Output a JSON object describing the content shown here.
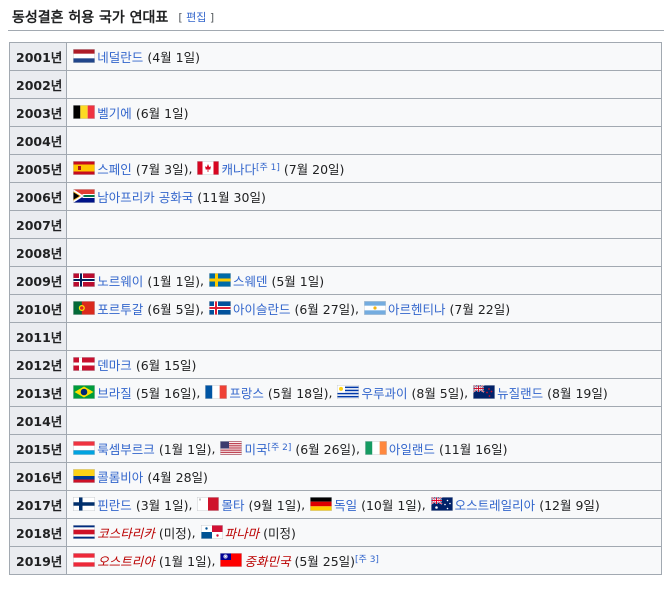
{
  "section": {
    "title": "동성결혼 허용 국가 연대표",
    "edit_open": "[",
    "edit_label": "편집",
    "edit_close": "]"
  },
  "rows": [
    {
      "year": "2001년",
      "entries": [
        {
          "flag": "netherlands-flag-icon",
          "name": "네덜란드",
          "date": "(4월 1일)"
        }
      ]
    },
    {
      "year": "2002년",
      "entries": []
    },
    {
      "year": "2003년",
      "entries": [
        {
          "flag": "belgium-flag-icon",
          "name": "벨기에",
          "date": "(6월 1일)"
        }
      ]
    },
    {
      "year": "2004년",
      "entries": []
    },
    {
      "year": "2005년",
      "entries": [
        {
          "flag": "spain-flag-icon",
          "name": "스페인",
          "date": "(7월 3일)"
        },
        {
          "flag": "canada-flag-icon",
          "name": "캐나다",
          "note": "[주 1]",
          "date": "(7월 20일)"
        }
      ]
    },
    {
      "year": "2006년",
      "entries": [
        {
          "flag": "south-africa-flag-icon",
          "name": "남아프리카 공화국",
          "date": "(11월 30일)"
        }
      ]
    },
    {
      "year": "2007년",
      "entries": []
    },
    {
      "year": "2008년",
      "entries": []
    },
    {
      "year": "2009년",
      "entries": [
        {
          "flag": "norway-flag-icon",
          "name": "노르웨이",
          "date": "(1월 1일)"
        },
        {
          "flag": "sweden-flag-icon",
          "name": "스웨덴",
          "date": "(5월 1일)"
        }
      ]
    },
    {
      "year": "2010년",
      "entries": [
        {
          "flag": "portugal-flag-icon",
          "name": "포르투갈",
          "date": "(6월 5일)"
        },
        {
          "flag": "iceland-flag-icon",
          "name": "아이슬란드",
          "date": "(6월 27일)"
        },
        {
          "flag": "argentina-flag-icon",
          "name": "아르헨티나",
          "date": "(7월 22일)"
        }
      ]
    },
    {
      "year": "2011년",
      "entries": []
    },
    {
      "year": "2012년",
      "entries": [
        {
          "flag": "denmark-flag-icon",
          "name": "덴마크",
          "date": "(6월 15일)"
        }
      ]
    },
    {
      "year": "2013년",
      "entries": [
        {
          "flag": "brazil-flag-icon",
          "name": "브라질",
          "date": "(5월 16일)"
        },
        {
          "flag": "france-flag-icon",
          "name": "프랑스",
          "date": "(5월 18일)"
        },
        {
          "flag": "uruguay-flag-icon",
          "name": "우루과이",
          "date": "(8월 5일)"
        },
        {
          "flag": "new-zealand-flag-icon",
          "name": "뉴질랜드",
          "date": "(8월 19일)"
        }
      ]
    },
    {
      "year": "2014년",
      "entries": []
    },
    {
      "year": "2015년",
      "entries": [
        {
          "flag": "luxembourg-flag-icon",
          "name": "룩셈부르크",
          "date": "(1월 1일)"
        },
        {
          "flag": "usa-flag-icon",
          "name": "미국",
          "note": "[주 2]",
          "date": "(6월 26일)"
        },
        {
          "flag": "ireland-flag-icon",
          "name": "아일랜드",
          "date": "(11월 16일)"
        }
      ]
    },
    {
      "year": "2016년",
      "entries": [
        {
          "flag": "colombia-flag-icon",
          "name": "콜롬비아",
          "date": "(4월 28일)"
        }
      ]
    },
    {
      "year": "2017년",
      "entries": [
        {
          "flag": "finland-flag-icon",
          "name": "핀란드",
          "date": "(3월 1일)"
        },
        {
          "flag": "malta-flag-icon",
          "name": "몰타",
          "date": "(9월 1일)"
        },
        {
          "flag": "germany-flag-icon",
          "name": "독일",
          "date": "(10월 1일)"
        },
        {
          "flag": "australia-flag-icon",
          "name": "오스트레일리아",
          "date": "(12월 9일)"
        }
      ]
    },
    {
      "year": "2018년",
      "entries": [
        {
          "flag": "costa-rica-flag-icon",
          "name": "코스타리카",
          "pending": true,
          "date": "(미정)"
        },
        {
          "flag": "panama-flag-icon",
          "name": "파나마",
          "pending": true,
          "date": "(미정)"
        }
      ]
    },
    {
      "year": "2019년",
      "entries": [
        {
          "flag": "austria-flag-icon",
          "name": "오스트리아",
          "pending": true,
          "date": "(1월 1일)"
        },
        {
          "flag": "taiwan-flag-icon",
          "name": "중화민국",
          "pending": true,
          "date": "(5월 25일)",
          "note": "[주 3]"
        }
      ]
    }
  ],
  "colors": {
    "link": "#3366cc",
    "pending_link": "#ba0000",
    "year_cell_bg": "#eaecf0",
    "border": "#a2a9b1"
  }
}
